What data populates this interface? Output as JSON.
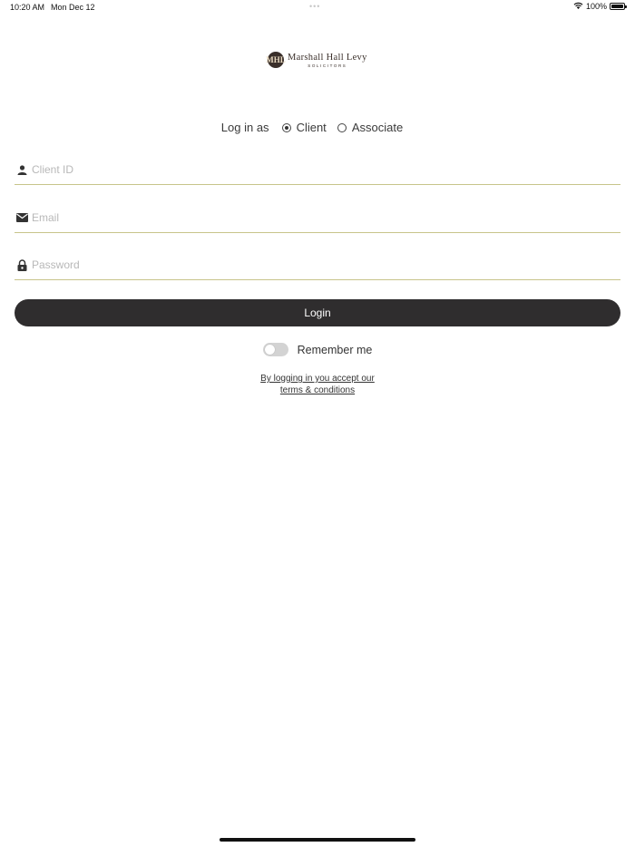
{
  "status_bar": {
    "time": "10:20 AM",
    "date": "Mon Dec 12",
    "battery": "100%",
    "wifi_icon": "wifi-icon",
    "battery_icon": "battery-icon"
  },
  "logo": {
    "mark": "MHL",
    "name": "Marshall Hall Levy",
    "subtitle": "SOLICITORS"
  },
  "login_as": {
    "label": "Log in as",
    "options": [
      {
        "label": "Client",
        "selected": true
      },
      {
        "label": "Associate",
        "selected": false
      }
    ]
  },
  "fields": {
    "client_id": {
      "placeholder": "Client ID",
      "value": "",
      "icon": "user-icon"
    },
    "email": {
      "placeholder": "Email",
      "value": "",
      "icon": "envelope-icon"
    },
    "password": {
      "placeholder": "Password",
      "value": "",
      "icon": "lock-icon"
    }
  },
  "login_button": "Login",
  "remember_me": {
    "label": "Remember me",
    "on": false
  },
  "terms": {
    "line1": "By logging in you accept our",
    "line2": "terms & conditions"
  },
  "colors": {
    "button_bg": "#2f2d2e",
    "field_underline": "#c7c48a",
    "logo_brown": "#3a2f2a"
  }
}
